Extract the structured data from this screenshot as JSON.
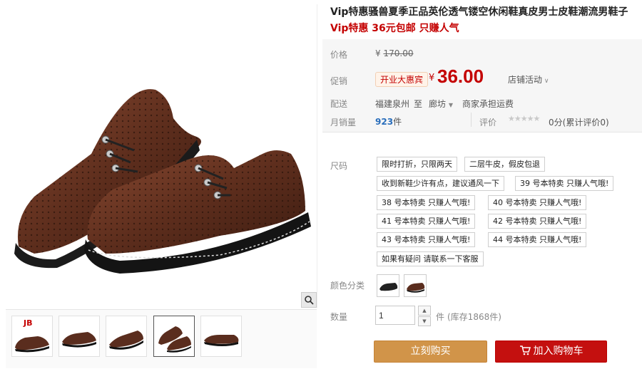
{
  "product": {
    "title": "Vip特惠骚兽夏季正品英伦透气镂空休闲鞋真皮男士皮鞋潮流男鞋子",
    "subtitle": "Vip特惠 36元包邮 只赚人气",
    "brand_logo_text": "JB",
    "icons": {
      "zoom": "magnifier-icon",
      "cart": "cart-icon",
      "dropdown": "caret-down-icon"
    }
  },
  "price": {
    "label": "价格",
    "original": "170.00",
    "currency": "¥",
    "promo_label": "促销",
    "promo_tag": "开业大惠宾",
    "promo_price": "36.00",
    "shop_activity": "店铺活动"
  },
  "delivery": {
    "label": "配送",
    "from": "福建泉州",
    "to_word": "至",
    "city": "廊坊",
    "fee": "商家承担运费"
  },
  "sales": {
    "label": "月销量",
    "count": "923",
    "unit": "件",
    "review_label": "评价",
    "rating_text": "0分(累计评价0)"
  },
  "size": {
    "label": "尺码",
    "options": [
      "限时打折，只限两天",
      "二层牛皮，假皮包退",
      "收到新鞋少许有点，建议通风一下",
      "39 号本特卖 只赚人气哦!",
      "38 号本特卖 只赚人气哦!",
      "40 号本特卖 只赚人气哦!",
      "41 号本特卖 只赚人气哦!",
      "42 号本特卖 只赚人气哦!",
      "43 号本特卖 只赚人气哦!",
      "44 号本特卖 只赚人气哦!",
      "如果有疑问 请联系一下客服"
    ]
  },
  "color": {
    "label": "颜色分类"
  },
  "quantity": {
    "label": "数量",
    "value": "1",
    "unit": "件",
    "stock": "(库存1868件)"
  },
  "actions": {
    "buy_now": "立刻购买",
    "add_to_cart": "加入购物车"
  },
  "colors": {
    "price_red": "#c40000",
    "buy_orange": "#d19449",
    "cart_red": "#c4100f",
    "shoe_brown": "#5a2d1e"
  }
}
